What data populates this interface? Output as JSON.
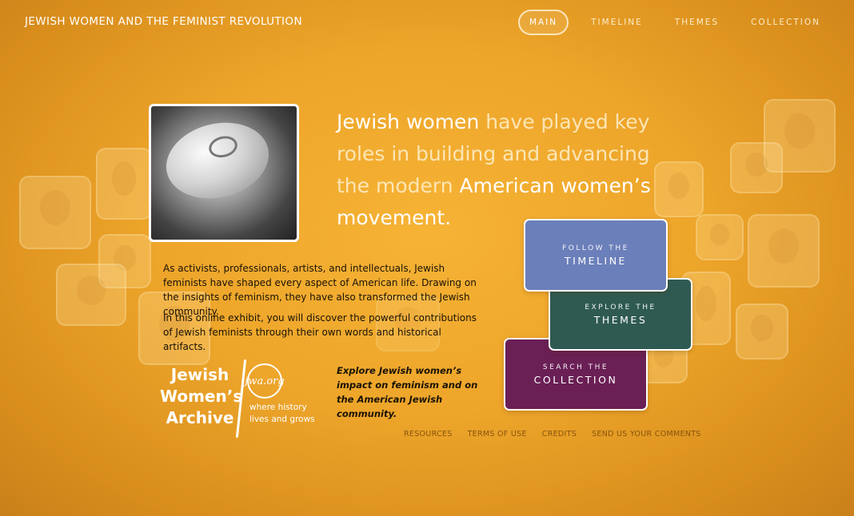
{
  "header": {
    "site_title": "JEWISH WOMEN AND THE FEMINIST REVOLUTION",
    "nav": [
      {
        "label": "MAIN",
        "active": true
      },
      {
        "label": "TIMELINE",
        "active": false
      },
      {
        "label": "THEMES",
        "active": false
      },
      {
        "label": "COLLECTION",
        "active": false
      }
    ]
  },
  "headline": {
    "part1": "Jewish women",
    "part2": " have played key roles in building and advancing the modern ",
    "part3": "American women’s movement.",
    "highlight_color": "#ffffff"
  },
  "intro": {
    "paragraph1": "As activists, professionals, artists, and intellectuals, Jewish feminists have shaped every aspect of American life. Drawing on the insights of feminism, they have also transformed the Jewish community.",
    "paragraph2": "In this online exhibit, you will discover the powerful contributions of Jewish feminists through their own words and historical artifacts."
  },
  "logo": {
    "name": "Jewish Women’s Archive",
    "circle_text": "jwa.org",
    "tagline": "where history lives and grows"
  },
  "callout": "Explore Jewish women’s impact on feminism and on the American Jewish community.",
  "cards": {
    "timeline": {
      "small": "FOLLOW THE",
      "big": "TIMELINE",
      "color": "#6b7fba"
    },
    "themes": {
      "small": "EXPLORE THE",
      "big": "THEMES",
      "color": "#2f5a52"
    },
    "collection": {
      "small": "SEARCH THE",
      "big": "COLLECTION",
      "color": "#6a1f55"
    }
  },
  "footer": {
    "links": [
      "RESOURCES",
      "TERMS OF USE",
      "CREDITS",
      "SEND US YOUR COMMENTS"
    ]
  },
  "colors": {
    "background": "#eda52a",
    "text_dark": "#1a1206"
  }
}
